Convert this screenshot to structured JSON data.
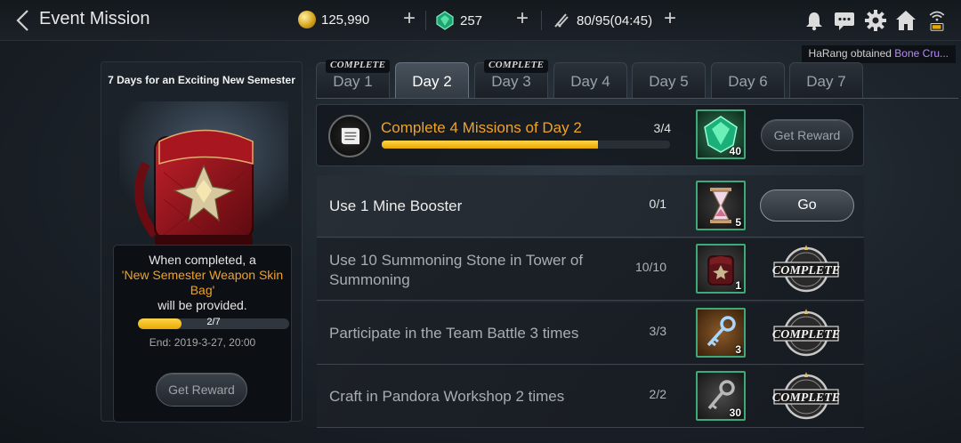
{
  "header": {
    "title": "Event Mission",
    "gold": "125,990",
    "gems": "257",
    "stamina": "80/95(04:45)",
    "notice_prefix": "HaRang obtained ",
    "notice_item": "Bone Cru..."
  },
  "colors": {
    "accent_orange": "#f0a228",
    "progress_yellow": "#ffd54a",
    "notice_purple": "#b48cf0"
  },
  "left_panel": {
    "title": "7 Days for an Exciting New Semester",
    "desc_line1": "When completed, a",
    "desc_item": "'New Semester Weapon Skin Bag'",
    "desc_line3": "will be provided.",
    "progress_text": "2/7",
    "progress_fraction": 0.2857,
    "end_text": "End: 2019-3-27, 20:00",
    "reward_button": "Get Reward",
    "icon": "backpack-icon"
  },
  "tabs": [
    {
      "label": "Day 1",
      "badge": "COMPLETE",
      "active": false
    },
    {
      "label": "Day 2",
      "badge": "",
      "active": true
    },
    {
      "label": "Day 3",
      "badge": "COMPLETE",
      "active": false
    },
    {
      "label": "Day 4",
      "badge": "",
      "active": false
    },
    {
      "label": "Day 5",
      "badge": "",
      "active": false
    },
    {
      "label": "Day 6",
      "badge": "",
      "active": false
    },
    {
      "label": "Day 7",
      "badge": "",
      "active": false
    }
  ],
  "main_mission": {
    "title": "Complete 4 Missions of Day 2",
    "count": "3/4",
    "progress_fraction": 0.75,
    "reward_qty": "40",
    "reward_icon": "green-gem-icon",
    "button": "Get Reward"
  },
  "missions": [
    {
      "text": "Use 1 Mine Booster",
      "count": "0/1",
      "reward_qty": "5",
      "reward_icon": "hourglass-icon",
      "action": "Go",
      "completed": false
    },
    {
      "text": "Use 10 Summoning Stone in Tower of Summoning",
      "count": "10/10",
      "reward_qty": "1",
      "reward_icon": "backpack-icon",
      "action": "COMPLETE",
      "completed": true
    },
    {
      "text": "Participate in the Team Battle 3 times",
      "count": "3/3",
      "reward_qty": "3",
      "reward_icon": "key-icon",
      "action": "COMPLETE",
      "completed": true
    },
    {
      "text": "Craft in Pandora Workshop 2 times",
      "count": "2/2",
      "reward_qty": "30",
      "reward_icon": "dark-key-icon",
      "action": "COMPLETE",
      "completed": true
    }
  ]
}
